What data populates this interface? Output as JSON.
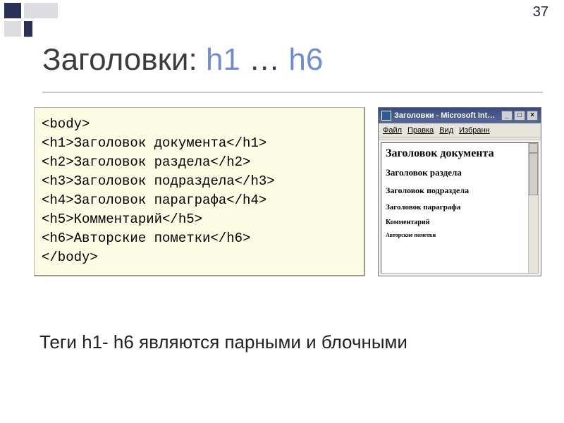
{
  "page_number": "37",
  "title": {
    "prefix": "Заголовки: ",
    "hl1": "h1",
    "mid": " … ",
    "hl2": "h6"
  },
  "code": {
    "l1": "<body>",
    "l2": "<h1>Заголовок документа</h1>",
    "l3": "<h2>Заголовок раздела</h2>",
    "l4": "<h3>Заголовок подраздела</h3>",
    "l5": "<h4>Заголовок параграфа</h4>",
    "l6": "<h5>Комментарий</h5>",
    "l7": "<h6>Авторские пометки</h6>",
    "l8": "</body>"
  },
  "browser": {
    "title": "Заголовки - Microsoft Intern…",
    "menu": {
      "file": "Файл",
      "edit": "Правка",
      "view": "Вид",
      "fav": "Избранн"
    },
    "h1": "Заголовок документа",
    "h2": "Заголовок раздела",
    "h3": "Заголовок подраздела",
    "h4": "Заголовок параграфа",
    "h5": "Комментарий",
    "h6": "Авторские пометки",
    "winbtn_min": "_",
    "winbtn_max": "□",
    "winbtn_close": "×"
  },
  "footer": "Теги h1- h6 являются парными и блочными"
}
